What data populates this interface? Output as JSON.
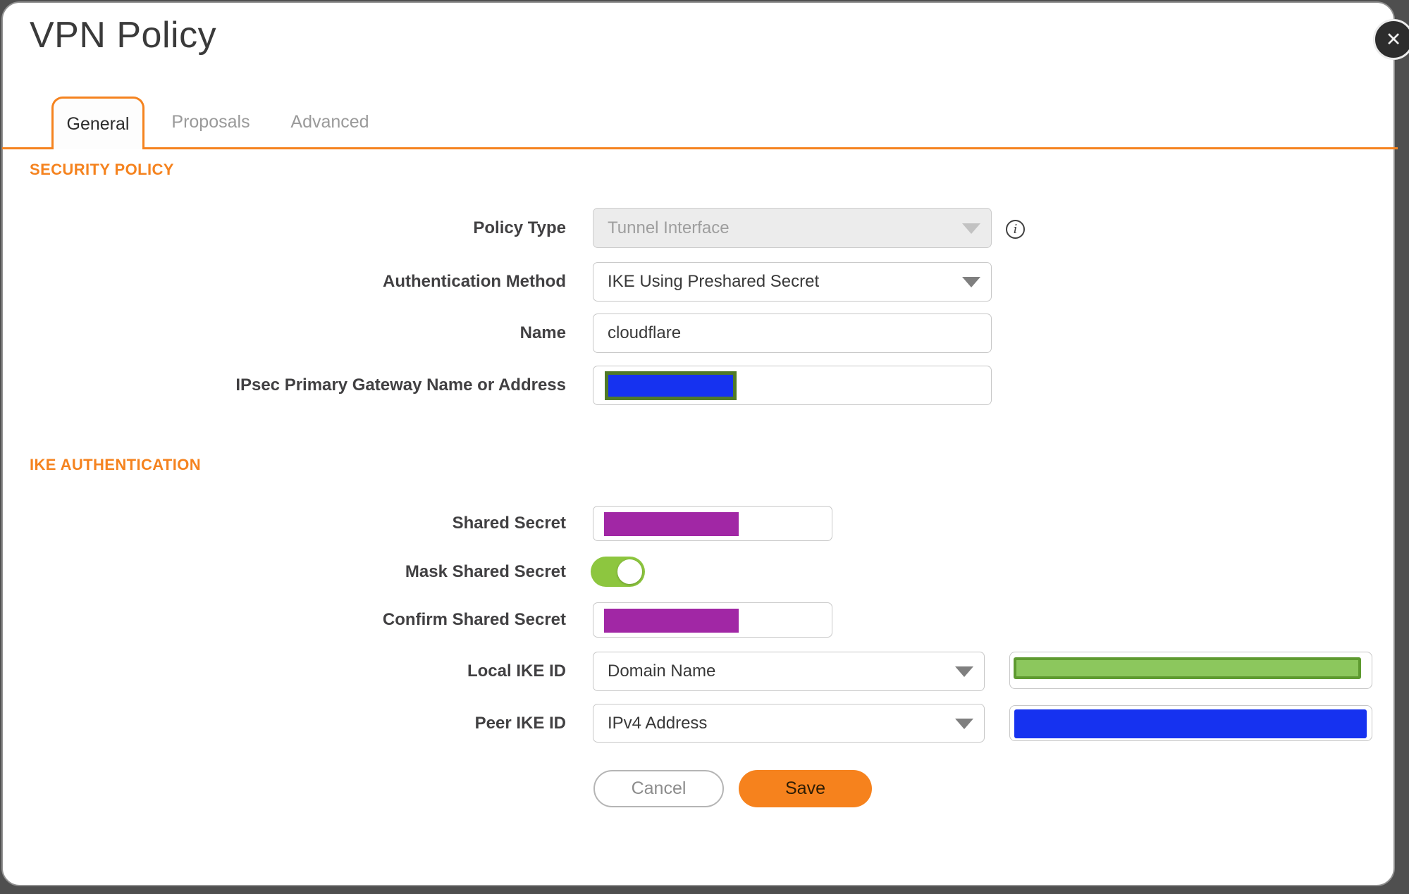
{
  "dialog": {
    "title": "VPN Policy"
  },
  "tabs": [
    {
      "label": "General",
      "active": true
    },
    {
      "label": "Proposals",
      "active": false
    },
    {
      "label": "Advanced",
      "active": false
    }
  ],
  "sections": {
    "security_policy": "SECURITY POLICY",
    "ike_authentication": "IKE AUTHENTICATION"
  },
  "fields": {
    "policy_type": {
      "label": "Policy Type",
      "value": "Tunnel Interface",
      "disabled": true
    },
    "auth_method": {
      "label": "Authentication Method",
      "value": "IKE Using Preshared Secret"
    },
    "name": {
      "label": "Name",
      "value": "cloudflare"
    },
    "gateway": {
      "label": "IPsec Primary Gateway Name or Address",
      "value": ""
    },
    "shared_secret": {
      "label": "Shared Secret",
      "value": ""
    },
    "mask_shared_secret": {
      "label": "Mask Shared Secret",
      "state": "on"
    },
    "confirm_shared_secret": {
      "label": "Confirm Shared Secret",
      "value": ""
    },
    "local_ike_id": {
      "label": "Local IKE ID",
      "value": "Domain Name"
    },
    "peer_ike_id": {
      "label": "Peer IKE ID",
      "value": "IPv4 Address"
    }
  },
  "buttons": {
    "cancel": "Cancel",
    "save": "Save"
  },
  "icons": {
    "close": "✕",
    "info": "i"
  },
  "colors": {
    "accent_orange": "#f5831f",
    "save_orange": "#f6821d",
    "toggle_on_green": "#8dc63f",
    "redaction_blue": "#1632f0",
    "redaction_blue_border": "#507a27",
    "redaction_purple": "#a127a5",
    "redaction_green_fill": "#8cc75d",
    "redaction_green_border": "#5e9a30",
    "backdrop_gray": "#4f4f4f"
  }
}
